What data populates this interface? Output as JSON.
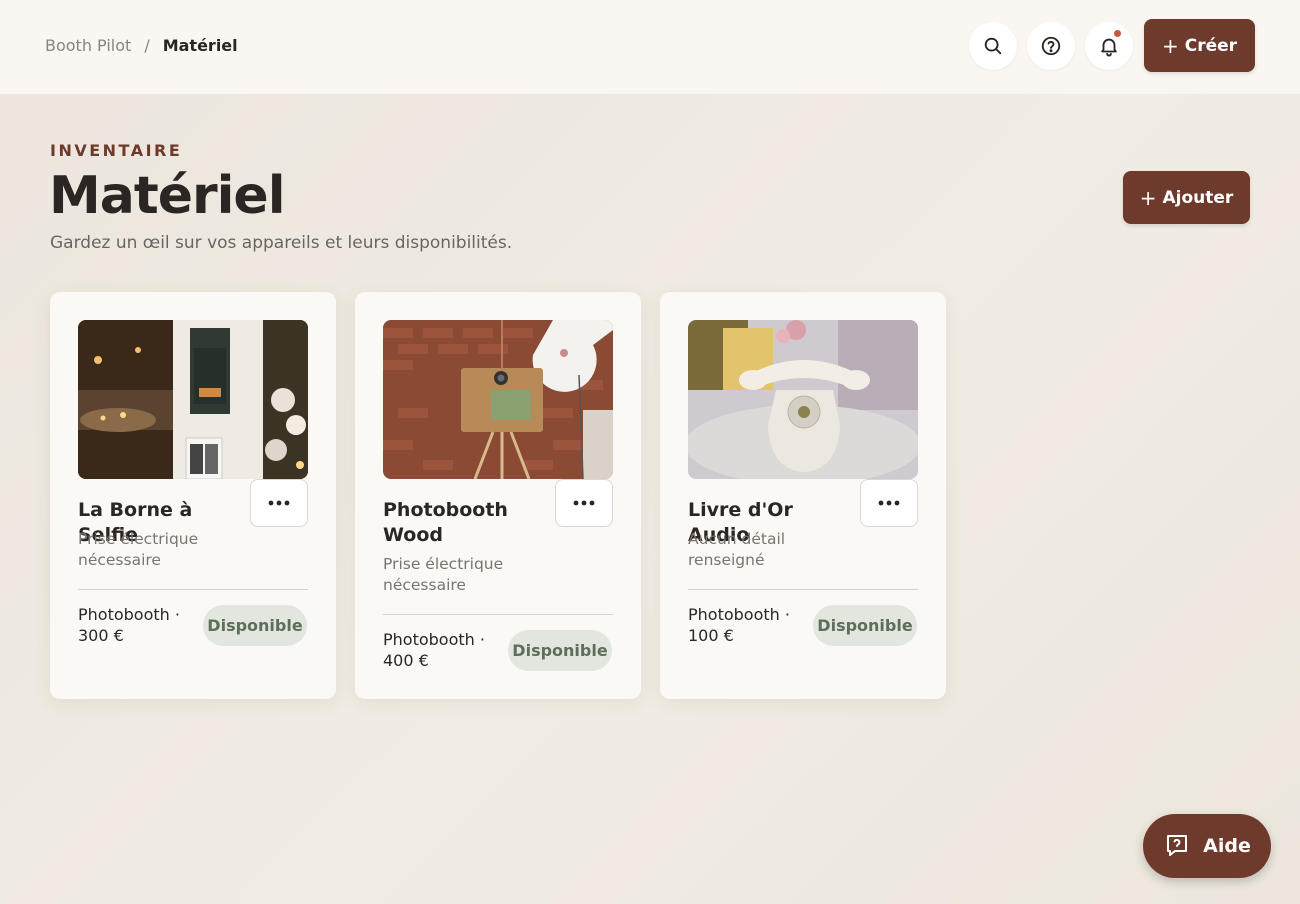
{
  "breadcrumb": {
    "root": "Booth Pilot",
    "separator": "/",
    "current": "Matériel"
  },
  "header": {
    "create_label": "Créer",
    "create_plus": "+"
  },
  "page": {
    "eyebrow": "INVENTAIRE",
    "title": "Matériel",
    "subtitle": "Gardez un œil sur vos appareils et leurs disponibilités.",
    "add_label": "Ajouter",
    "add_plus": "+"
  },
  "cards": [
    {
      "title": "La Borne à Selfie",
      "description": "Prise électrique nécessaire",
      "price": "Photobooth · 300 €",
      "status": "Disponible",
      "image": "selfie-booth-photo"
    },
    {
      "title": "Photobooth Wood",
      "description": "Prise électrique nécessaire",
      "price": "Photobooth · 400 €",
      "status": "Disponible",
      "image": "wood-photobooth-photo"
    },
    {
      "title": "Livre d'Or Audio",
      "description": "Aucun détail renseigné",
      "price": "Photobooth · 100 €",
      "status": "Disponible",
      "image": "audio-guestbook-phone-photo"
    }
  ],
  "help": {
    "label": "Aide"
  },
  "icons": {
    "search": "search-icon",
    "help": "help-circle-icon",
    "notifications": "bell-icon",
    "more": "more-horizontal-icon",
    "chat": "chat-icon"
  },
  "colors": {
    "brand": "#6e3a2b",
    "badge_bg": "#e2e6de",
    "badge_text": "#5d6e5b",
    "notification_dot": "#c9573d"
  }
}
